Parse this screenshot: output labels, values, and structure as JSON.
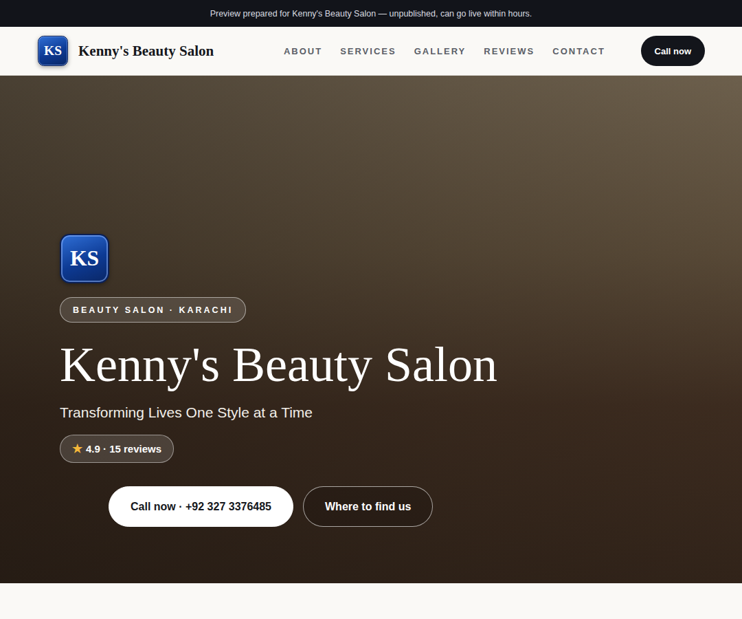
{
  "banner": {
    "text": "Preview prepared for Kenny's Beauty Salon — unpublished, can go live within hours."
  },
  "header": {
    "logo": "KS",
    "brand": "Kenny's Beauty Salon",
    "nav": [
      {
        "label": "ABOUT"
      },
      {
        "label": "SERVICES"
      },
      {
        "label": "GALLERY"
      },
      {
        "label": "REVIEWS"
      },
      {
        "label": "CONTACT"
      }
    ],
    "cta": "Call now"
  },
  "hero": {
    "logo": "KS",
    "badge": "BEAUTY SALON · KARACHI",
    "title": "Kenny's Beauty Salon",
    "subtitle": "Transforming Lives One Style at a Time",
    "rating": {
      "star": "★",
      "text": "4.9 · 15 reviews"
    },
    "buttons": [
      {
        "label": "Call now · +92 327 3376485",
        "kind": "primary"
      },
      {
        "label": "Where to find us",
        "kind": "outline"
      }
    ]
  }
}
